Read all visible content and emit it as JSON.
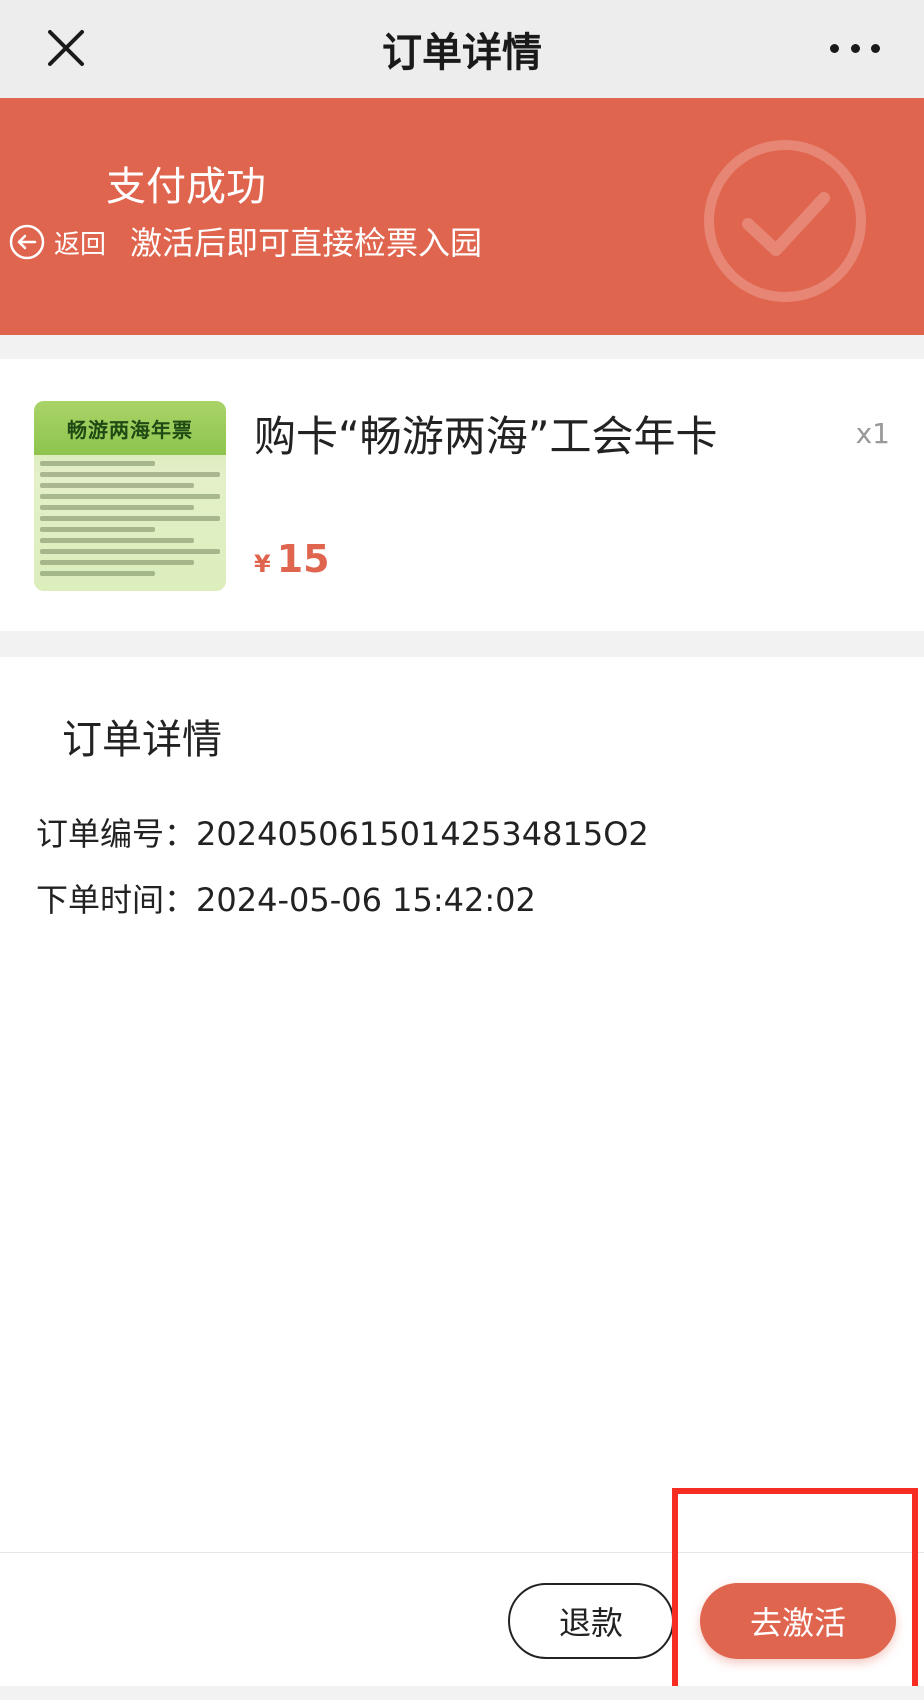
{
  "navbar": {
    "title": "订单详情",
    "close_icon": "close-icon",
    "more_icon": "more-icon"
  },
  "banner": {
    "title": "支付成功",
    "subtitle": "激活后即可直接检票入园",
    "back_label": "返回",
    "color": "#e0654f"
  },
  "product": {
    "thumb_title": "畅游两海年票",
    "name": "购卡“畅游两海”工会年卡",
    "quantity": "x1",
    "price_symbol": "¥",
    "price_value": "15"
  },
  "details": {
    "title": "订单详情",
    "order_number_label": "订单编号：",
    "order_number": "20240506150142534815O2",
    "order_time_label": "下单时间：",
    "order_time": "2024-05-06 15:42:02"
  },
  "actions": {
    "refund_label": "退款",
    "activate_label": "去激活",
    "accent": "#e0654f",
    "highlight": "#f52d23"
  }
}
